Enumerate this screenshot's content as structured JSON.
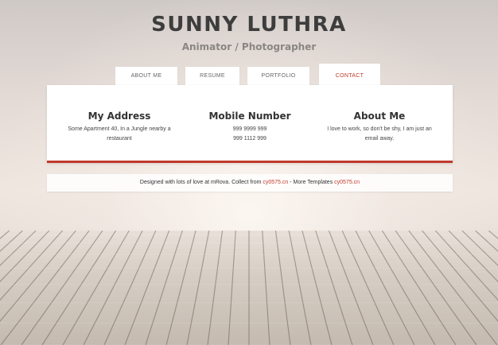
{
  "header": {
    "name": "SUNNY LUTHRA",
    "subtitle": "Animator / Photographer"
  },
  "tabs": [
    {
      "label": "ABOUT ME",
      "active": false
    },
    {
      "label": "RESUME",
      "active": false
    },
    {
      "label": "PORTFOLIO",
      "active": false
    },
    {
      "label": "CONTACT",
      "active": true
    }
  ],
  "contact": {
    "address": {
      "title": "My Address",
      "lines": [
        "Some Apartment 40, In a Jungle nearby a",
        "restaurant"
      ]
    },
    "mobile": {
      "title": "Mobile Number",
      "lines": [
        "999 9999 999",
        "999 1112 999"
      ]
    },
    "about": {
      "title": "About Me",
      "lines": [
        "I love to work, so don't be shy, I am just an",
        "email away."
      ]
    }
  },
  "footer": {
    "text": "Designed with lots of love at mRova. Collect from ",
    "link1": "cy0575.cn",
    "middle": " - More Templates ",
    "link2": "cy0575.cn"
  },
  "colors": {
    "accent": "#c0392b",
    "panel": "#ffffff",
    "title": "#3d3d3d"
  }
}
